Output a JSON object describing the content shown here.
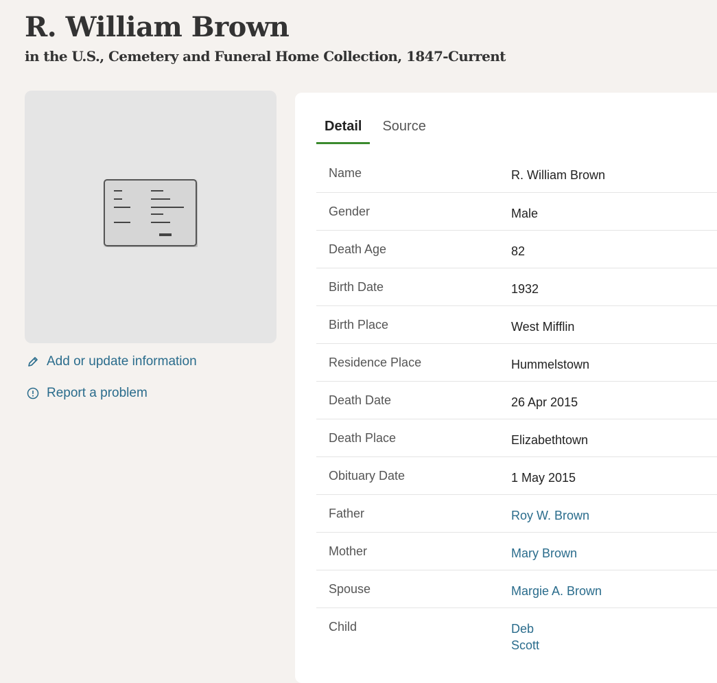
{
  "header": {
    "title": "R. William Brown",
    "subtitle": "in the U.S., Cemetery and Funeral Home Collection, 1847-Current"
  },
  "image_placeholder": {
    "icon": "document-record-icon"
  },
  "side_links": {
    "add_update": {
      "icon": "pencil-icon",
      "label": "Add or update information"
    },
    "report": {
      "icon": "alert-circle-icon",
      "label": "Report a problem"
    }
  },
  "tabs": {
    "detail": "Detail",
    "source": "Source"
  },
  "details": {
    "name": {
      "label": "Name",
      "value": "R. William Brown"
    },
    "gender": {
      "label": "Gender",
      "value": "Male"
    },
    "death_age": {
      "label": "Death Age",
      "value": "82"
    },
    "birth_date": {
      "label": "Birth Date",
      "value": "1932"
    },
    "birth_place": {
      "label": "Birth Place",
      "value": "West Mifflin"
    },
    "residence_place": {
      "label": "Residence Place",
      "value": "Hummelstown"
    },
    "death_date": {
      "label": "Death Date",
      "value": "26 Apr 2015"
    },
    "death_place": {
      "label": "Death Place",
      "value": "Elizabethtown"
    },
    "obituary_date": {
      "label": "Obituary Date",
      "value": "1 May 2015"
    },
    "father": {
      "label": "Father",
      "value": "Roy W. Brown"
    },
    "mother": {
      "label": "Mother",
      "value": "Mary Brown"
    },
    "spouse": {
      "label": "Spouse",
      "value": "Margie A. Brown"
    },
    "child": {
      "label": "Child",
      "values": [
        "Deb",
        "Scott"
      ]
    }
  },
  "colors": {
    "page_bg": "#f5f2ef",
    "link": "#2a6c8c",
    "active_tab_underline": "#3a8a2e"
  }
}
